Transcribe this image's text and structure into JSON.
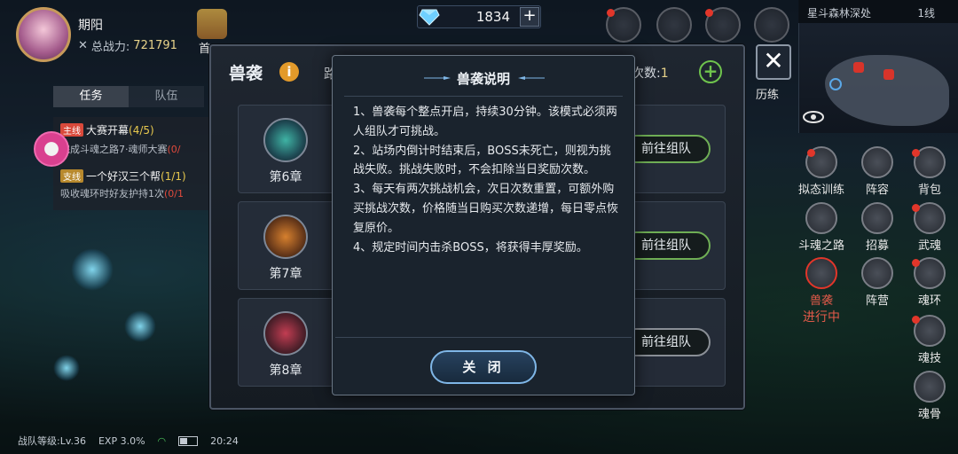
{
  "player": {
    "name": "期阳",
    "power_label": "总战力:",
    "power_value": "721791"
  },
  "currency": {
    "diamonds": "1834",
    "plus": "+"
  },
  "minimap": {
    "location": "星斗森林深处",
    "line": "1线"
  },
  "side_labels": {
    "first_recharge": "首",
    "training": "历练"
  },
  "right_menu": [
    {
      "label": "拟态训练"
    },
    {
      "label": "阵容"
    },
    {
      "label": "背包"
    },
    {
      "label": "斗魂之路"
    },
    {
      "label": "招募"
    },
    {
      "label": "武魂"
    },
    {
      "label": "兽袭",
      "sub": "进行中"
    },
    {
      "label": "阵营"
    },
    {
      "label": "魂环"
    },
    {
      "label": "魂技"
    },
    {
      "label": "魂骨"
    }
  ],
  "quest_panel": {
    "tab_tasks": "任务",
    "tab_team": "队伍",
    "quests": [
      {
        "tag": "主线",
        "title": "大赛开幕",
        "progress": "(4/5)",
        "desc": "完成斗魂之路7·魂师大赛",
        "desc_red": "(0/"
      },
      {
        "tag": "支线",
        "title": "一个好汉三个帮",
        "progress": "(1/1)",
        "desc": "吸收魂环时好友护持1次",
        "desc_red": "(0/1"
      }
    ]
  },
  "status_bar": {
    "level": "战队等级:Lv.36",
    "exp": "EXP 3.0%",
    "time": "20:24"
  },
  "raid": {
    "title": "兽袭",
    "info": "i",
    "route": "路",
    "attempts_label": "次数:",
    "attempts_value": "1",
    "attempts_plus": "+",
    "chapters": [
      {
        "label": "第6章",
        "button": "前往组队"
      },
      {
        "label": "第7章",
        "button": "前往组队"
      },
      {
        "label": "第8章",
        "button": "前往组队"
      }
    ]
  },
  "dialog": {
    "title": "兽袭说明",
    "items": [
      "1、兽袭每个整点开启，持续30分钟。该模式必须两人组队才可挑战。",
      "2、站场内倒计时结束后，BOSS未死亡，则视为挑战失败。挑战失败时，不会扣除当日奖励次数。",
      "3、每天有两次挑战机会，次日次数重置，可额外购买挑战次数，价格随当日购买次数递增，每日零点恢复原价。",
      "4、规定时间内击杀BOSS，将获得丰厚奖励。"
    ],
    "close_label": "关 闭"
  },
  "colors": {
    "accent_green": "#6fc44d",
    "accent_blue": "#7fb6e6",
    "alert_red": "#e2362a",
    "info_orange": "#e39a2a"
  }
}
